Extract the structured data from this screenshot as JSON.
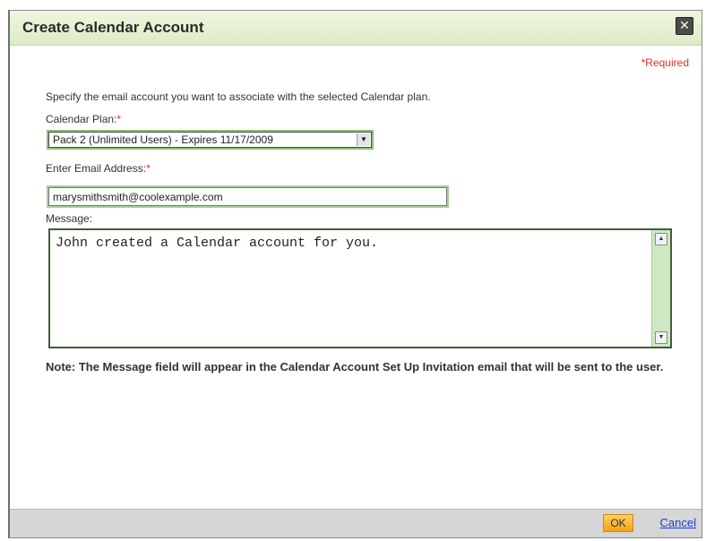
{
  "dialog": {
    "title": "Create Calendar Account",
    "close_icon": "close-icon",
    "required_note": "*Required",
    "instructions": "Specify the email account you want to associate with the selected Calendar plan."
  },
  "calendar_plan": {
    "label": "Calendar Plan:",
    "required_mark": "*",
    "selected": "Pack 2 (Unlimited Users) - Expires 11/17/2009",
    "arrow_icon": "chevron-down-icon"
  },
  "email": {
    "label": "Enter Email Address:",
    "required_mark": "*",
    "value": "marysmithsmith@coolexample.com"
  },
  "message": {
    "label": "Message:",
    "value": "John created a Calendar account for you."
  },
  "note": "Note: The Message field will appear in the Calendar Account Set Up Invitation email that will be sent to the user.",
  "footer": {
    "ok_label": "OK",
    "cancel_label": "Cancel"
  },
  "colors": {
    "title_bar": "#dcecc4",
    "required": "#e0302a",
    "ok_button": "#f5a313",
    "link": "#1a3fd8",
    "footer": "#d6d6d6"
  }
}
